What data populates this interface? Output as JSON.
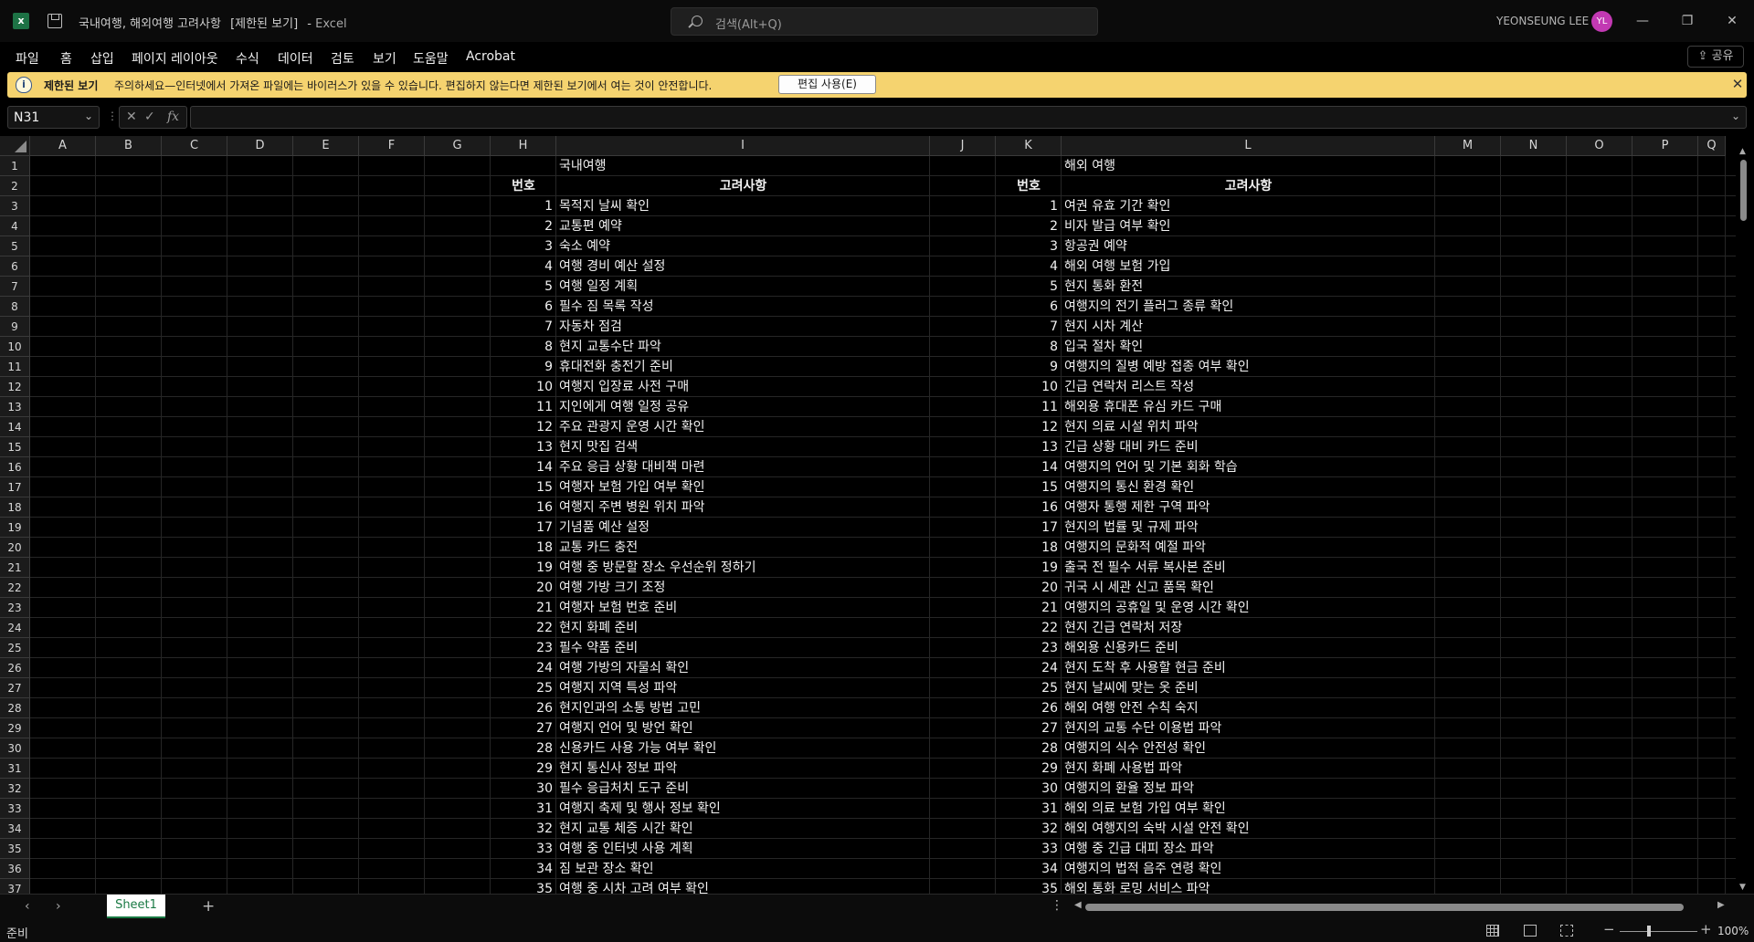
{
  "titlebar": {
    "doc_title": "국내여행, 해외여행 고려사항",
    "restricted": "[제한된 보기]",
    "separator": "-",
    "app_name": "Excel",
    "search_placeholder": "검색(Alt+Q)",
    "user_name": "YEONSEUNG LEE",
    "avatar_initials": "YL",
    "minimize": "—",
    "restore": "❐",
    "close": "✕"
  },
  "menu": [
    "파일",
    "홈",
    "삽입",
    "페이지 레이아웃",
    "수식",
    "데이터",
    "검토",
    "보기",
    "도움말",
    "Acrobat"
  ],
  "share_label": "공유",
  "message_bar": {
    "title": "제한된 보기",
    "text": "주의하세요—인터넷에서 가져온 파일에는 바이러스가 있을 수 있습니다. 편집하지 않는다면 제한된 보기에서 여는 것이 안전합니다.",
    "button": "편집 사용(E)",
    "close": "✕"
  },
  "formula_bar": {
    "name_box": "N31",
    "formula": ""
  },
  "columns": [
    "A",
    "B",
    "C",
    "D",
    "E",
    "F",
    "G",
    "H",
    "I",
    "J",
    "K",
    "L",
    "M",
    "N",
    "O",
    "P",
    "Q"
  ],
  "rows": [
    "1",
    "2",
    "3",
    "4",
    "5",
    "6",
    "7",
    "8",
    "9",
    "10",
    "11",
    "12",
    "13",
    "14",
    "15",
    "16",
    "17",
    "18",
    "19",
    "20",
    "21",
    "22",
    "23",
    "24",
    "25",
    "26",
    "27",
    "28",
    "29",
    "30",
    "31",
    "32",
    "33",
    "34",
    "35",
    "36",
    "37"
  ],
  "domestic": {
    "title": "국내여행",
    "num_header": "번호",
    "text_header": "고려사항",
    "items": [
      [
        "1",
        "목적지 날씨 확인"
      ],
      [
        "2",
        "교통편 예약"
      ],
      [
        "3",
        "숙소 예약"
      ],
      [
        "4",
        "여행 경비 예산 설정"
      ],
      [
        "5",
        "여행 일정 계획"
      ],
      [
        "6",
        "필수 짐 목록 작성"
      ],
      [
        "7",
        "자동차 점검"
      ],
      [
        "8",
        "현지 교통수단 파악"
      ],
      [
        "9",
        "휴대전화 충전기 준비"
      ],
      [
        "10",
        "여행지 입장료 사전 구매"
      ],
      [
        "11",
        "지인에게 여행 일정 공유"
      ],
      [
        "12",
        "주요 관광지 운영 시간 확인"
      ],
      [
        "13",
        "현지 맛집 검색"
      ],
      [
        "14",
        "주요 응급 상황 대비책 마련"
      ],
      [
        "15",
        "여행자 보험 가입 여부 확인"
      ],
      [
        "16",
        "여행지 주변 병원 위치 파악"
      ],
      [
        "17",
        "기념품 예산 설정"
      ],
      [
        "18",
        "교통 카드 충전"
      ],
      [
        "19",
        "여행 중 방문할 장소 우선순위 정하기"
      ],
      [
        "20",
        "여행 가방 크기 조정"
      ],
      [
        "21",
        "여행자 보험 번호 준비"
      ],
      [
        "22",
        "현지 화폐 준비"
      ],
      [
        "23",
        "필수 약품 준비"
      ],
      [
        "24",
        "여행 가방의 자물쇠 확인"
      ],
      [
        "25",
        "여행지 지역 특성 파악"
      ],
      [
        "26",
        "현지인과의 소통 방법 고민"
      ],
      [
        "27",
        "여행지 언어 및 방언 확인"
      ],
      [
        "28",
        "신용카드 사용 가능 여부 확인"
      ],
      [
        "29",
        "현지 통신사 정보 파악"
      ],
      [
        "30",
        "필수 응급처치 도구 준비"
      ],
      [
        "31",
        "여행지 축제 및 행사 정보 확인"
      ],
      [
        "32",
        "현지 교통 체증 시간 확인"
      ],
      [
        "33",
        "여행 중 인터넷 사용 계획"
      ],
      [
        "34",
        "짐 보관 장소 확인"
      ],
      [
        "35",
        "여행 중 시차 고려 여부 확인"
      ]
    ]
  },
  "overseas": {
    "title": "해외 여행",
    "num_header": "번호",
    "text_header": "고려사항",
    "items": [
      [
        "1",
        "여권 유효 기간 확인"
      ],
      [
        "2",
        "비자 발급 여부 확인"
      ],
      [
        "3",
        "항공권 예약"
      ],
      [
        "4",
        "해외 여행 보험 가입"
      ],
      [
        "5",
        "현지 통화 환전"
      ],
      [
        "6",
        "여행지의 전기 플러그 종류 확인"
      ],
      [
        "7",
        "현지 시차 계산"
      ],
      [
        "8",
        "입국 절차 확인"
      ],
      [
        "9",
        "여행지의 질병 예방 접종 여부 확인"
      ],
      [
        "10",
        "긴급 연락처 리스트 작성"
      ],
      [
        "11",
        "해외용 휴대폰 유심 카드 구매"
      ],
      [
        "12",
        "현지 의료 시설 위치 파악"
      ],
      [
        "13",
        "긴급 상황 대비 카드 준비"
      ],
      [
        "14",
        "여행지의 언어 및 기본 회화 학습"
      ],
      [
        "15",
        "여행지의 통신 환경 확인"
      ],
      [
        "16",
        "여행자 통행 제한 구역 파악"
      ],
      [
        "17",
        "현지의 법률 및 규제 파악"
      ],
      [
        "18",
        "여행지의 문화적 예절 파악"
      ],
      [
        "19",
        "출국 전 필수 서류 복사본 준비"
      ],
      [
        "20",
        "귀국 시 세관 신고 품목 확인"
      ],
      [
        "21",
        "여행지의 공휴일 및 운영 시간 확인"
      ],
      [
        "22",
        "현지 긴급 연락처 저장"
      ],
      [
        "23",
        "해외용 신용카드 준비"
      ],
      [
        "24",
        "현지 도착 후 사용할 현금 준비"
      ],
      [
        "25",
        "현지 날씨에 맞는 옷 준비"
      ],
      [
        "26",
        "해외 여행 안전 수칙 숙지"
      ],
      [
        "27",
        "현지의 교통 수단 이용법 파악"
      ],
      [
        "28",
        "여행지의 식수 안전성 확인"
      ],
      [
        "29",
        "현지 화폐 사용법 파악"
      ],
      [
        "30",
        "여행지의 환율 정보 파악"
      ],
      [
        "31",
        "해외 의료 보험 가입 여부 확인"
      ],
      [
        "32",
        "해외 여행지의 숙박 시설 안전 확인"
      ],
      [
        "33",
        "여행 중 긴급 대피 장소 파악"
      ],
      [
        "34",
        "여행지의 법적 음주 연령 확인"
      ],
      [
        "35",
        "해외 통화 로밍 서비스 파악"
      ]
    ]
  },
  "sheet_tabs": [
    "Sheet1"
  ],
  "status": {
    "ready": "준비",
    "zoom": "100%"
  }
}
